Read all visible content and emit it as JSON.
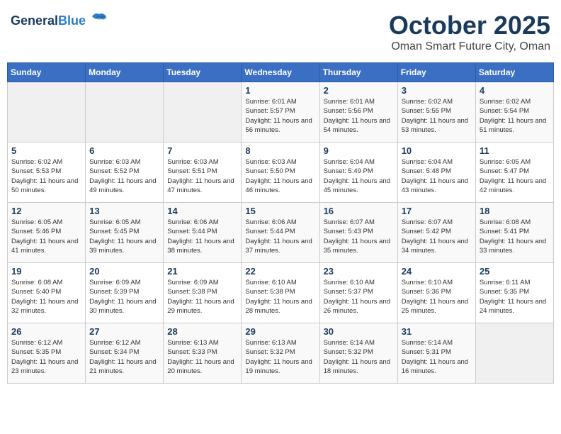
{
  "header": {
    "logo_line1": "General",
    "logo_line2": "Blue",
    "month": "October 2025",
    "location": "Oman Smart Future City, Oman"
  },
  "weekdays": [
    "Sunday",
    "Monday",
    "Tuesday",
    "Wednesday",
    "Thursday",
    "Friday",
    "Saturday"
  ],
  "weeks": [
    [
      {
        "day": "",
        "info": ""
      },
      {
        "day": "",
        "info": ""
      },
      {
        "day": "",
        "info": ""
      },
      {
        "day": "1",
        "info": "Sunrise: 6:01 AM\nSunset: 5:57 PM\nDaylight: 11 hours and 56 minutes."
      },
      {
        "day": "2",
        "info": "Sunrise: 6:01 AM\nSunset: 5:56 PM\nDaylight: 11 hours and 54 minutes."
      },
      {
        "day": "3",
        "info": "Sunrise: 6:02 AM\nSunset: 5:55 PM\nDaylight: 11 hours and 53 minutes."
      },
      {
        "day": "4",
        "info": "Sunrise: 6:02 AM\nSunset: 5:54 PM\nDaylight: 11 hours and 51 minutes."
      }
    ],
    [
      {
        "day": "5",
        "info": "Sunrise: 6:02 AM\nSunset: 5:53 PM\nDaylight: 11 hours and 50 minutes."
      },
      {
        "day": "6",
        "info": "Sunrise: 6:03 AM\nSunset: 5:52 PM\nDaylight: 11 hours and 49 minutes."
      },
      {
        "day": "7",
        "info": "Sunrise: 6:03 AM\nSunset: 5:51 PM\nDaylight: 11 hours and 47 minutes."
      },
      {
        "day": "8",
        "info": "Sunrise: 6:03 AM\nSunset: 5:50 PM\nDaylight: 11 hours and 46 minutes."
      },
      {
        "day": "9",
        "info": "Sunrise: 6:04 AM\nSunset: 5:49 PM\nDaylight: 11 hours and 45 minutes."
      },
      {
        "day": "10",
        "info": "Sunrise: 6:04 AM\nSunset: 5:48 PM\nDaylight: 11 hours and 43 minutes."
      },
      {
        "day": "11",
        "info": "Sunrise: 6:05 AM\nSunset: 5:47 PM\nDaylight: 11 hours and 42 minutes."
      }
    ],
    [
      {
        "day": "12",
        "info": "Sunrise: 6:05 AM\nSunset: 5:46 PM\nDaylight: 11 hours and 41 minutes."
      },
      {
        "day": "13",
        "info": "Sunrise: 6:05 AM\nSunset: 5:45 PM\nDaylight: 11 hours and 39 minutes."
      },
      {
        "day": "14",
        "info": "Sunrise: 6:06 AM\nSunset: 5:44 PM\nDaylight: 11 hours and 38 minutes."
      },
      {
        "day": "15",
        "info": "Sunrise: 6:06 AM\nSunset: 5:44 PM\nDaylight: 11 hours and 37 minutes."
      },
      {
        "day": "16",
        "info": "Sunrise: 6:07 AM\nSunset: 5:43 PM\nDaylight: 11 hours and 35 minutes."
      },
      {
        "day": "17",
        "info": "Sunrise: 6:07 AM\nSunset: 5:42 PM\nDaylight: 11 hours and 34 minutes."
      },
      {
        "day": "18",
        "info": "Sunrise: 6:08 AM\nSunset: 5:41 PM\nDaylight: 11 hours and 33 minutes."
      }
    ],
    [
      {
        "day": "19",
        "info": "Sunrise: 6:08 AM\nSunset: 5:40 PM\nDaylight: 11 hours and 32 minutes."
      },
      {
        "day": "20",
        "info": "Sunrise: 6:09 AM\nSunset: 5:39 PM\nDaylight: 11 hours and 30 minutes."
      },
      {
        "day": "21",
        "info": "Sunrise: 6:09 AM\nSunset: 5:38 PM\nDaylight: 11 hours and 29 minutes."
      },
      {
        "day": "22",
        "info": "Sunrise: 6:10 AM\nSunset: 5:38 PM\nDaylight: 11 hours and 28 minutes."
      },
      {
        "day": "23",
        "info": "Sunrise: 6:10 AM\nSunset: 5:37 PM\nDaylight: 11 hours and 26 minutes."
      },
      {
        "day": "24",
        "info": "Sunrise: 6:10 AM\nSunset: 5:36 PM\nDaylight: 11 hours and 25 minutes."
      },
      {
        "day": "25",
        "info": "Sunrise: 6:11 AM\nSunset: 5:35 PM\nDaylight: 11 hours and 24 minutes."
      }
    ],
    [
      {
        "day": "26",
        "info": "Sunrise: 6:12 AM\nSunset: 5:35 PM\nDaylight: 11 hours and 23 minutes."
      },
      {
        "day": "27",
        "info": "Sunrise: 6:12 AM\nSunset: 5:34 PM\nDaylight: 11 hours and 21 minutes."
      },
      {
        "day": "28",
        "info": "Sunrise: 6:13 AM\nSunset: 5:33 PM\nDaylight: 11 hours and 20 minutes."
      },
      {
        "day": "29",
        "info": "Sunrise: 6:13 AM\nSunset: 5:32 PM\nDaylight: 11 hours and 19 minutes."
      },
      {
        "day": "30",
        "info": "Sunrise: 6:14 AM\nSunset: 5:32 PM\nDaylight: 11 hours and 18 minutes."
      },
      {
        "day": "31",
        "info": "Sunrise: 6:14 AM\nSunset: 5:31 PM\nDaylight: 11 hours and 16 minutes."
      },
      {
        "day": "",
        "info": ""
      }
    ]
  ]
}
